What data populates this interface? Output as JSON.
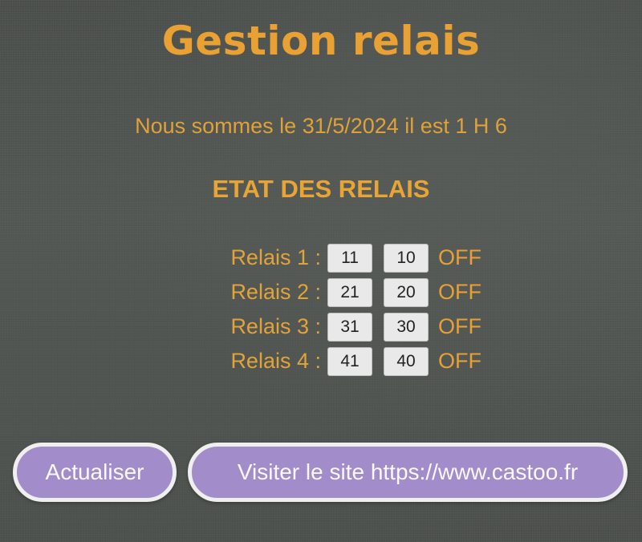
{
  "page": {
    "title": "Gestion relais",
    "datetime_text": "Nous sommes le 31/5/2024 il est 1 H 6",
    "section_heading": "ETAT DES RELAIS"
  },
  "relays": [
    {
      "label": "Relais 1 :",
      "on_button": "11",
      "off_button": "10",
      "state": "OFF"
    },
    {
      "label": "Relais 2 :",
      "on_button": "21",
      "off_button": "20",
      "state": "OFF"
    },
    {
      "label": "Relais 3 :",
      "on_button": "31",
      "off_button": "30",
      "state": "OFF"
    },
    {
      "label": "Relais 4 :",
      "on_button": "41",
      "off_button": "40",
      "state": "OFF"
    }
  ],
  "actions": {
    "refresh_label": "Actualiser",
    "visit_label": "Visiter le site https://www.castoo.fr"
  },
  "colors": {
    "text_accent": "#e8a132",
    "button_purple": "#a28cc9",
    "button_border": "#f0efef",
    "background": "#4e524f"
  }
}
